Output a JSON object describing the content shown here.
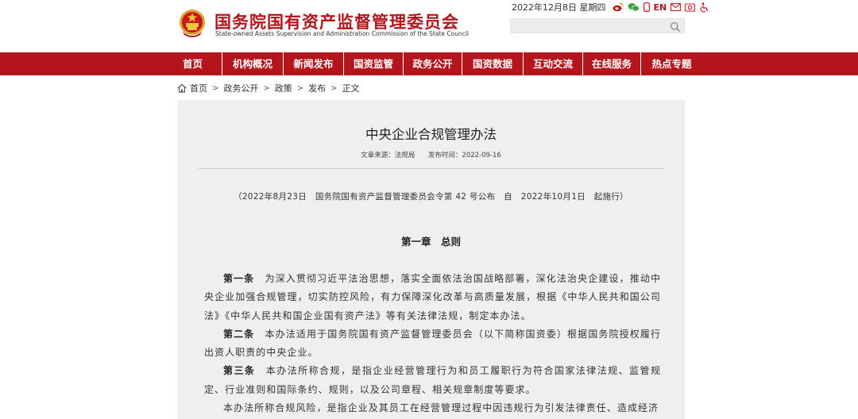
{
  "header": {
    "title": "国务院国有资产监督管理委员会",
    "subtitle": "State-owned Assets Supervision and Administration Commission of the State Council",
    "date": "2022年12月8日 星期四",
    "en_label": "EN",
    "search_placeholder": ""
  },
  "nav": {
    "items": [
      "首页",
      "机构概况",
      "新闻发布",
      "国资监管",
      "政务公开",
      "国资数据",
      "互动交流",
      "在线服务",
      "热点专题"
    ]
  },
  "breadcrumb": {
    "items": [
      "首页",
      "政务公开",
      "政策",
      "发布"
    ],
    "current": "正文",
    "sep": ">"
  },
  "article": {
    "title": "中央企业合规管理办法",
    "source": "文章来源：法规局",
    "publish_time": "发布时间：2022-09-16",
    "note": "（2022年8月23日　国务院国有资产监督管理委员会令第 42 号公布　自　2022年10月1日　起施行）",
    "chapter": "第一章　总则",
    "paragraphs": [
      {
        "lead": "第一条",
        "text": "　为深入贯彻习近平法治思想，落实全面依法治国战略部署，深化法治央企建设，推动中央企业加强合规管理，切实防控风险，有力保障深化改革与高质量发展，根据《中华人民共和国公司法》《中华人民共和国企业国有资产法》等有关法律法规，制定本办法。"
      },
      {
        "lead": "第二条",
        "text": "　本办法适用于国务院国有资产监督管理委员会（以下简称国资委）根据国务院授权履行出资人职责的中央企业。"
      },
      {
        "lead": "第三条",
        "text": "　本办法所称合规，是指企业经营管理行为和员工履职行为符合国家法律法规、监管规定、行业准则和国际条约、规则，以及公司章程、相关规章制度等要求。"
      },
      {
        "lead": "",
        "text": "本办法所称合规风险，是指企业及其员工在经营管理过程中因违规行为引发法律责任、造成经济"
      }
    ]
  },
  "colors": {
    "brand_red": "#b4141b",
    "article_bg": "#efefef"
  },
  "icons": [
    "emblem-icon",
    "weibo-icon",
    "wechat-icon",
    "mobile-icon",
    "mail-icon",
    "share-icon",
    "accessibility-icon",
    "search-icon",
    "home-icon"
  ]
}
